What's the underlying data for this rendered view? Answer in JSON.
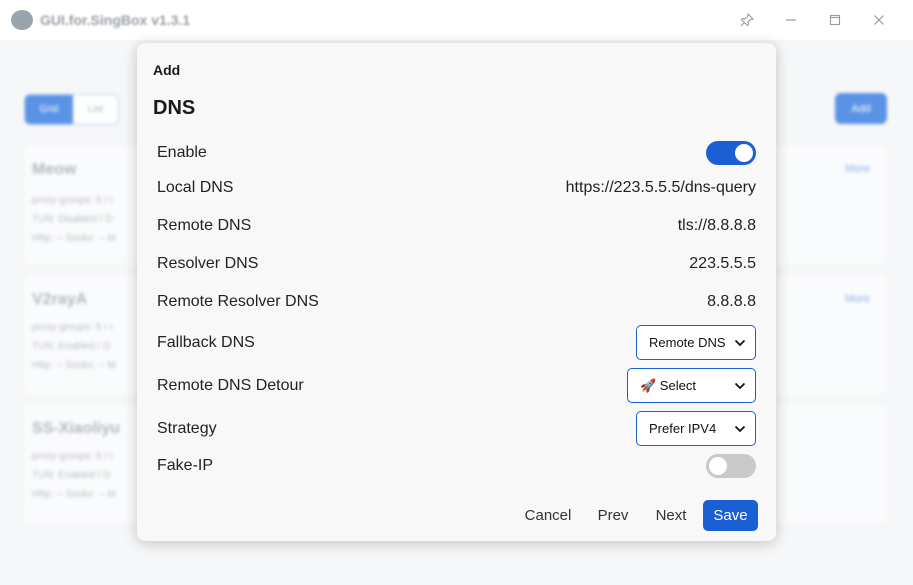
{
  "window": {
    "title": "GUI.for.SingBox v1.3.1",
    "controls": [
      "pin-icon",
      "minimize-icon",
      "maximize-icon",
      "close-icon"
    ]
  },
  "background": {
    "view_tabs": [
      "Grid",
      "List"
    ],
    "add_label": "Add",
    "profiles": [
      {
        "name": "Meow",
        "lines": [
          "proxy-groups: 5 / r",
          "TUN: Disabled / D",
          "Http: -- Socks: -- M"
        ],
        "more": "More"
      },
      {
        "name": "V2rayA",
        "lines": [
          "proxy-groups: 5 / r",
          "TUN: Enabled / D",
          "Http: -- Socks: -- M"
        ],
        "more": "More"
      },
      {
        "name": "SS-Xiaoliyu",
        "lines": [
          "proxy-groups: 5 / r",
          "TUN: Enabled / D",
          "Http: -- Socks: -- M"
        ],
        "more": ""
      }
    ]
  },
  "dialog": {
    "title": "Add",
    "heading": "DNS",
    "fields": {
      "enable": {
        "label": "Enable",
        "on": true
      },
      "local_dns": {
        "label": "Local DNS",
        "value": "https://223.5.5.5/dns-query"
      },
      "remote_dns": {
        "label": "Remote DNS",
        "value": "tls://8.8.8.8"
      },
      "resolver_dns": {
        "label": "Resolver DNS",
        "value": "223.5.5.5"
      },
      "remote_resolver_dns": {
        "label": "Remote Resolver DNS",
        "value": "8.8.8.8"
      },
      "fallback_dns": {
        "label": "Fallback DNS",
        "selected": "Remote DNS"
      },
      "remote_dns_detour": {
        "label": "Remote DNS Detour",
        "selected": "🚀 Select"
      },
      "strategy": {
        "label": "Strategy",
        "selected": "Prefer IPV4"
      },
      "fake_ip": {
        "label": "Fake-IP",
        "on": false
      }
    },
    "buttons": {
      "cancel": "Cancel",
      "prev": "Prev",
      "next": "Next",
      "save": "Save"
    }
  },
  "colors": {
    "accent": "#1a5fd3",
    "toggle_off": "#c9c9c9",
    "dialog_bg": "#f8f8f8"
  }
}
